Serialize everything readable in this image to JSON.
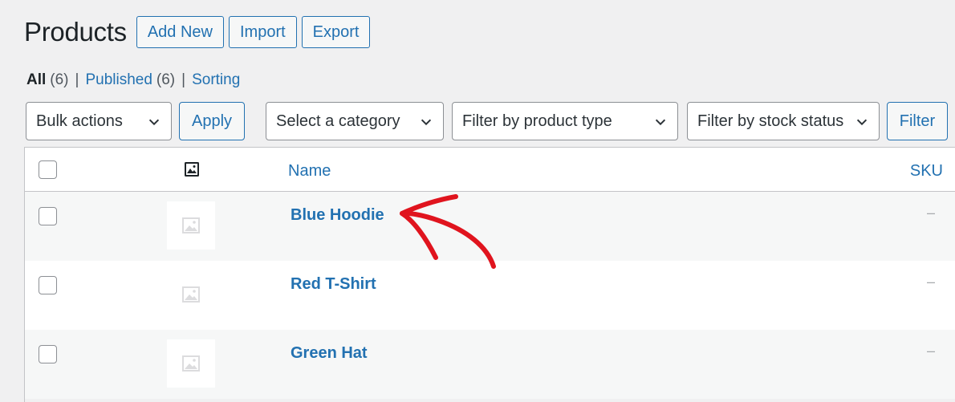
{
  "header": {
    "title": "Products",
    "buttons": {
      "add_new": "Add New",
      "import": "Import",
      "export": "Export"
    }
  },
  "views": {
    "all_label": "All",
    "all_count": "(6)",
    "published_label": "Published",
    "published_count": "(6)",
    "sorting_label": "Sorting",
    "separator": "|"
  },
  "filters": {
    "bulk_actions": "Bulk actions",
    "apply": "Apply",
    "category": "Select a category",
    "product_type": "Filter by product type",
    "stock_status": "Filter by stock status",
    "filter": "Filter"
  },
  "table": {
    "columns": {
      "name": "Name",
      "sku": "SKU"
    },
    "rows": [
      {
        "name": "Blue Hoodie",
        "sku": "–"
      },
      {
        "name": "Red T-Shirt",
        "sku": "–"
      },
      {
        "name": "Green Hat",
        "sku": "–"
      }
    ]
  },
  "annotation": {
    "arrow_color": "#e0141e"
  },
  "colors": {
    "accent": "#2271b1",
    "background": "#f0f0f1"
  }
}
